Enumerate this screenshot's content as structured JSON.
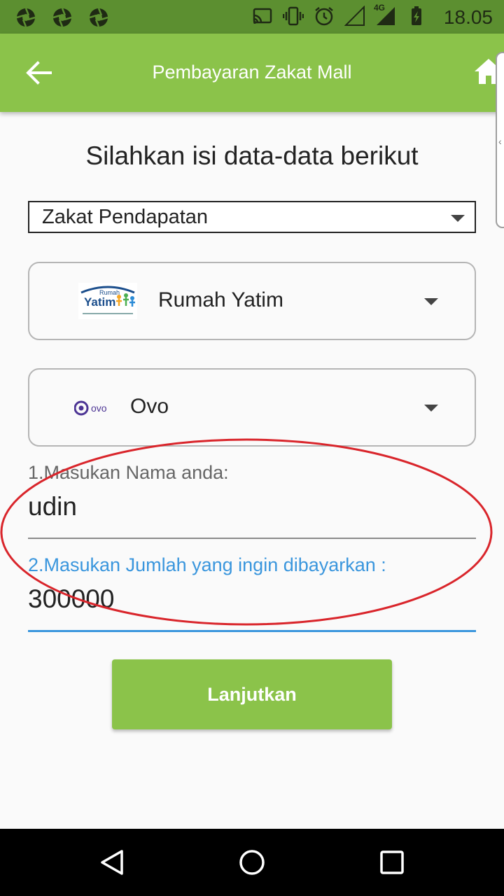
{
  "status_bar": {
    "time": "18.05",
    "network_label": "4G",
    "left_icons": [
      "aperture-icon",
      "aperture-icon",
      "aperture-icon"
    ],
    "right_icons": [
      "cast-icon",
      "vibrate-icon",
      "alarm-icon",
      "signal-empty-icon",
      "signal-4g-icon",
      "battery-charging-icon"
    ]
  },
  "app_bar": {
    "title": "Pembayaran Zakat Mall",
    "back_icon": "arrow-left-icon",
    "home_icon": "home-icon",
    "background": "#8bc34a"
  },
  "form": {
    "heading": "Silahkan isi data-data berikut",
    "zakat_type": {
      "selected": "Zakat Pendapatan"
    },
    "organization": {
      "selected": "Rumah Yatim",
      "logo_text_top": "Rumah",
      "logo_text_main": "Yatim"
    },
    "payment_method": {
      "selected": "Ovo",
      "logo_text": "ovo"
    },
    "name_field": {
      "label": "1.Masukan Nama anda:",
      "value": "udin"
    },
    "amount_field": {
      "label": "2.Masukan Jumlah yang ingin dibayarkan :",
      "value": "300000"
    },
    "submit_label": "Lanjutkan"
  },
  "colors": {
    "status_bar": "#5c8f30",
    "primary": "#8bc34a",
    "focus_blue": "#3a96dd",
    "annotation_red": "#d9252b"
  },
  "nav_bar": {
    "icons": [
      "back-triangle-icon",
      "home-circle-icon",
      "recents-square-icon"
    ]
  }
}
